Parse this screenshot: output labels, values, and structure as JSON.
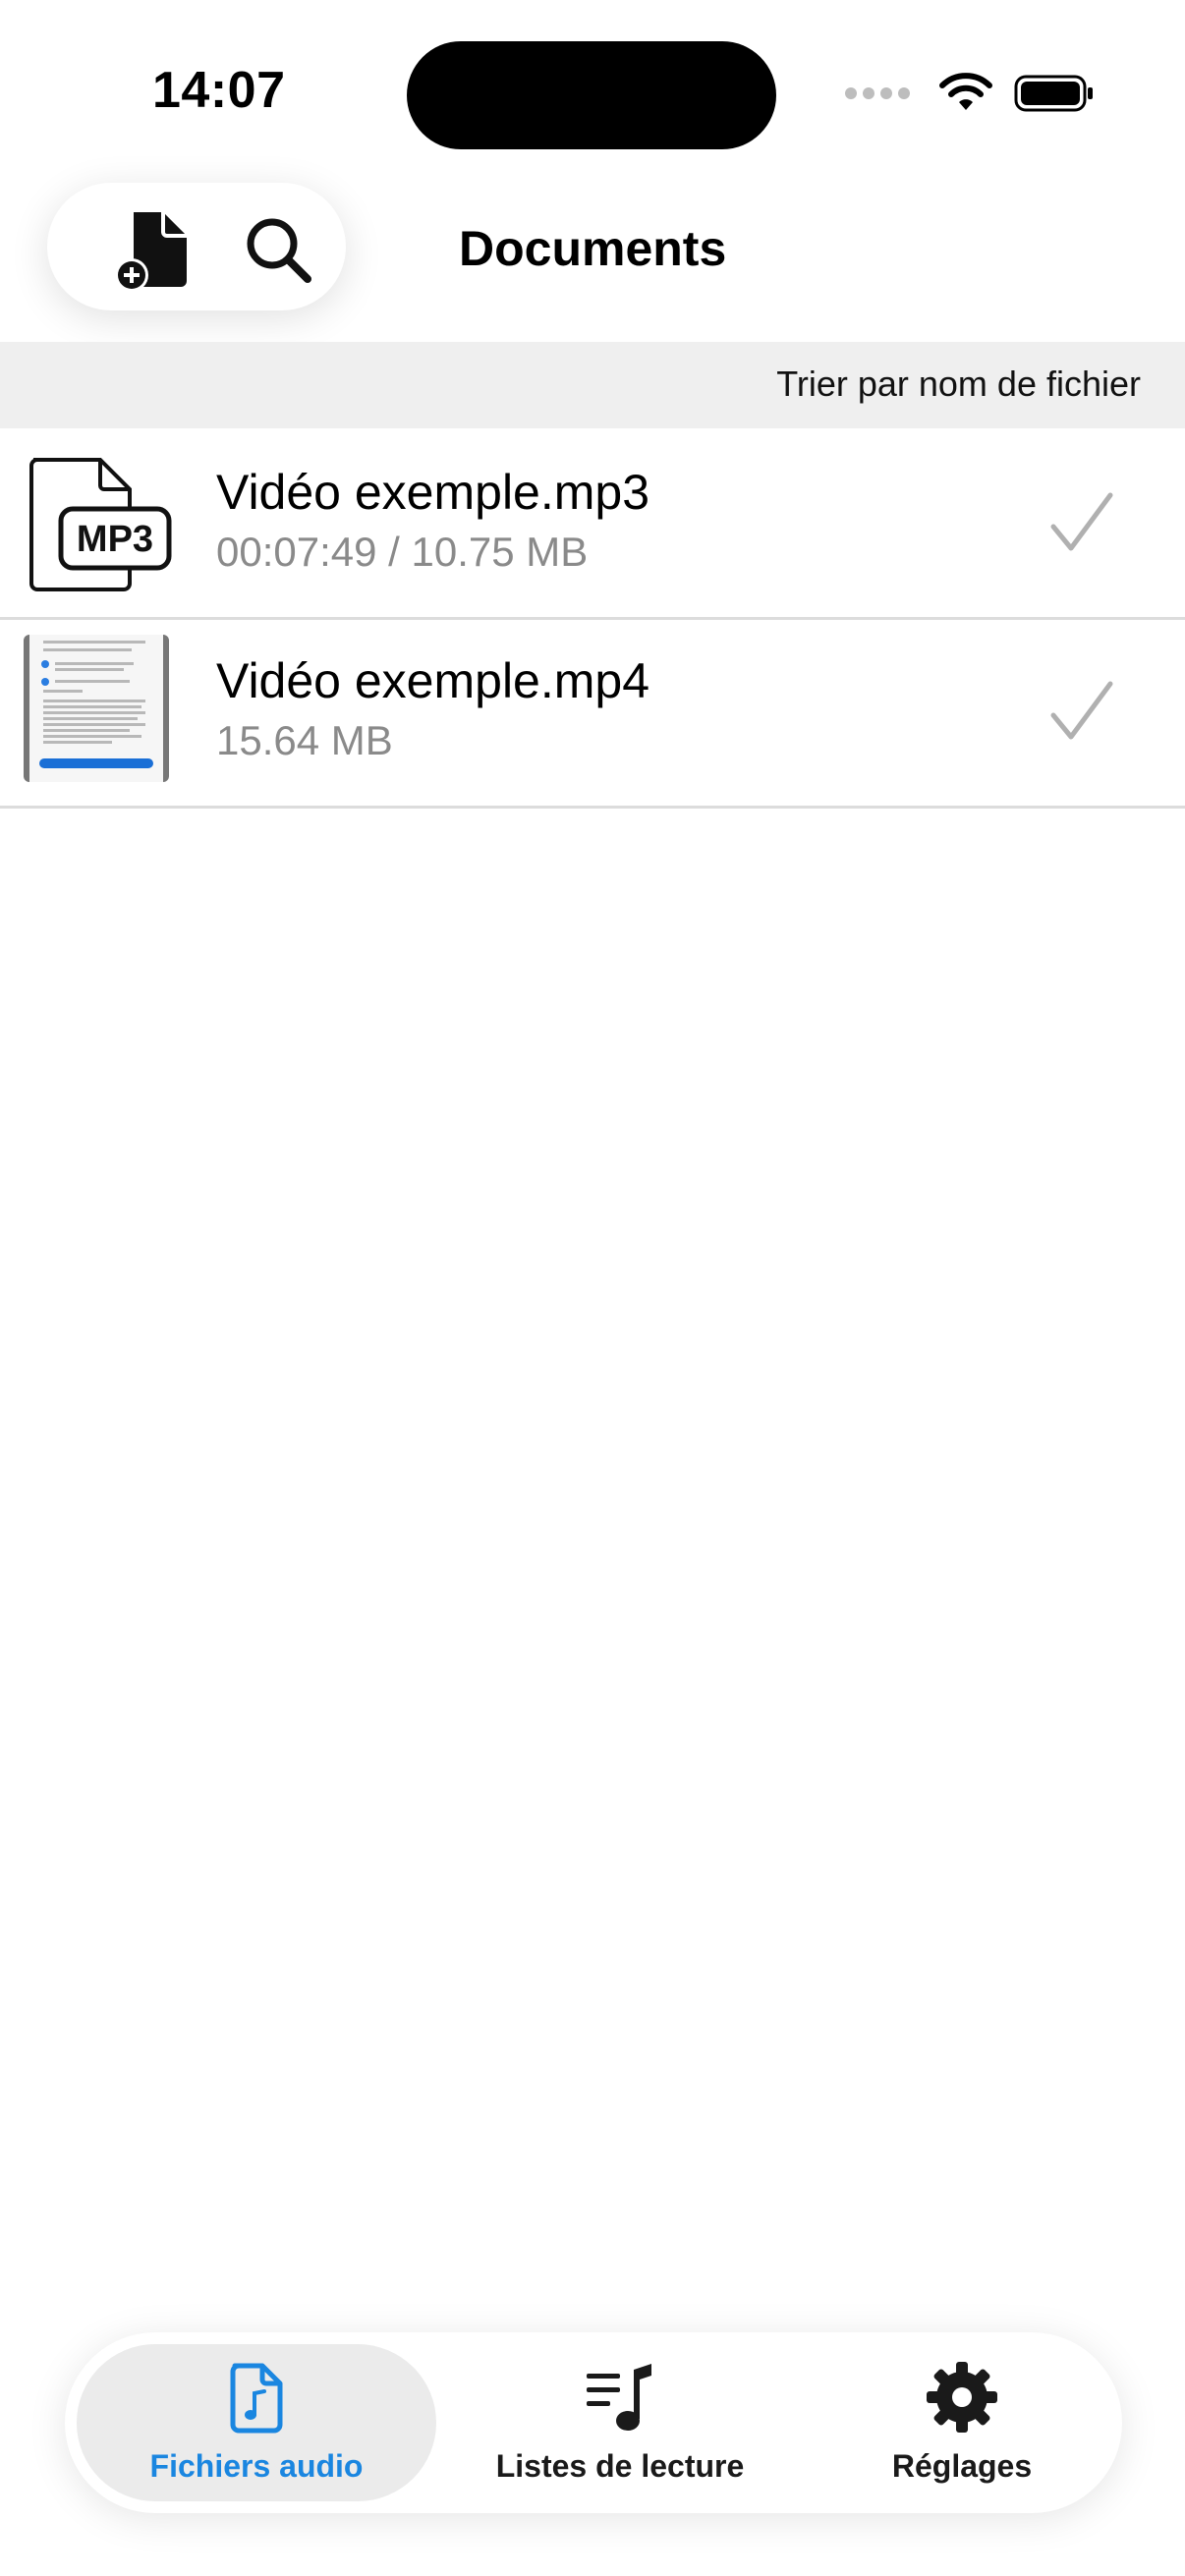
{
  "status_bar": {
    "time": "14:07"
  },
  "header": {
    "title": "Documents",
    "add_icon": "add-document-icon",
    "search_icon": "search-icon"
  },
  "sort": {
    "label": "Trier par nom de fichier"
  },
  "files": [
    {
      "name": "Vidéo exemple.mp3",
      "meta": "00:07:49 / 10.75 MB",
      "thumb_text": "MP3",
      "icon": "mp3-file-icon",
      "status_icon": "checkmark-icon"
    },
    {
      "name": "Vidéo exemple.mp4",
      "meta": "15.64 MB",
      "icon": "video-thumbnail",
      "status_icon": "checkmark-icon"
    }
  ],
  "tabs": [
    {
      "label": "Fichiers audio",
      "icon": "audio-file-icon",
      "selected": true
    },
    {
      "label": "Listes de lecture",
      "icon": "playlist-icon",
      "selected": false
    },
    {
      "label": "Réglages",
      "icon": "gear-icon",
      "selected": false
    }
  ],
  "colors": {
    "accent": "#1a86e0",
    "secondary_text": "#8a8a8a",
    "sort_bar_bg": "#efefef",
    "selected_tab_bg": "#ebebeb"
  }
}
